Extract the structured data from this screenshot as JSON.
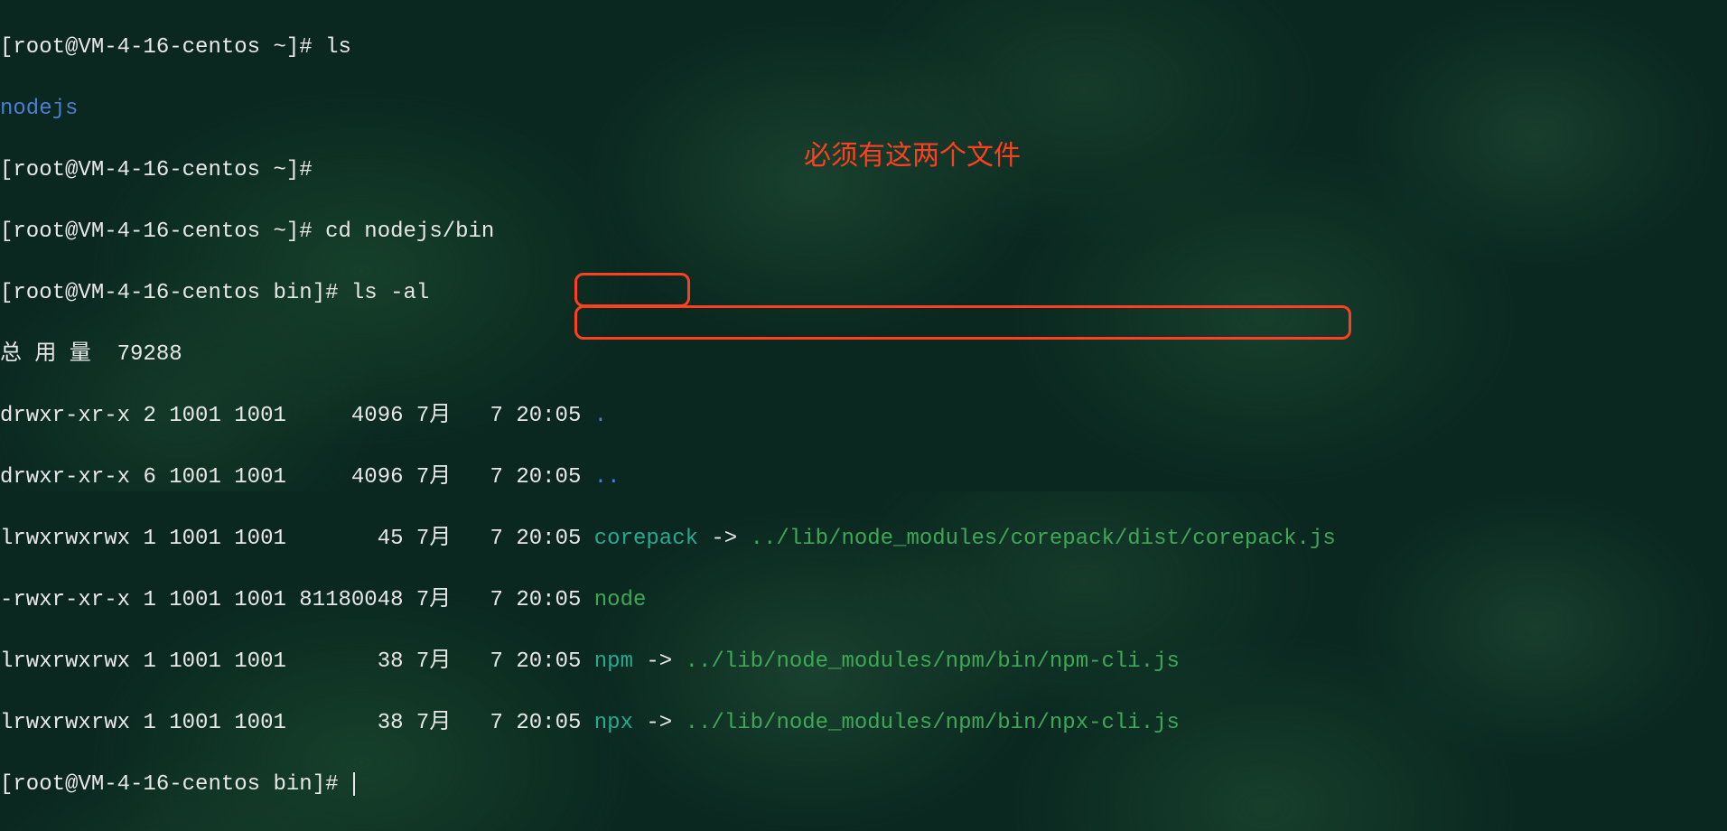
{
  "prompt": {
    "user": "root",
    "host": "VM-4-16-centos",
    "home_cwd": "~",
    "bin_cwd": "bin",
    "suffix": "#"
  },
  "commands": {
    "ls": "ls",
    "empty": "",
    "cd": "cd nodejs/bin",
    "lsal": "ls -al"
  },
  "ls_output": {
    "nodejs": "nodejs"
  },
  "lsal": {
    "total_label": "总 用 量",
    "total_value": "79288",
    "rows": [
      {
        "perms": "drwxr-xr-x",
        "links": "2",
        "owner": "1001",
        "group": "1001",
        "size": "4096",
        "month": "7月",
        "day": "7",
        "time": "20:05",
        "name": ".",
        "type": "dir"
      },
      {
        "perms": "drwxr-xr-x",
        "links": "6",
        "owner": "1001",
        "group": "1001",
        "size": "4096",
        "month": "7月",
        "day": "7",
        "time": "20:05",
        "name": "..",
        "type": "dir"
      },
      {
        "perms": "lrwxrwxrwx",
        "links": "1",
        "owner": "1001",
        "group": "1001",
        "size": "45",
        "month": "7月",
        "day": "7",
        "time": "20:05",
        "name": "corepack",
        "type": "link",
        "arrow": "->",
        "target": "../lib/node_modules/corepack/dist/corepack.js"
      },
      {
        "perms": "-rwxr-xr-x",
        "links": "1",
        "owner": "1001",
        "group": "1001",
        "size": "81180048",
        "month": "7月",
        "day": "7",
        "time": "20:05",
        "name": "node",
        "type": "exec"
      },
      {
        "perms": "lrwxrwxrwx",
        "links": "1",
        "owner": "1001",
        "group": "1001",
        "size": "38",
        "month": "7月",
        "day": "7",
        "time": "20:05",
        "name": "npm",
        "type": "link",
        "arrow": "->",
        "target": "../lib/node_modules/npm/bin/npm-cli.js"
      },
      {
        "perms": "lrwxrwxrwx",
        "links": "1",
        "owner": "1001",
        "group": "1001",
        "size": "38",
        "month": "7月",
        "day": "7",
        "time": "20:05",
        "name": "npx",
        "type": "link",
        "arrow": "->",
        "target": "../lib/node_modules/npm/bin/npx-cli.js"
      }
    ]
  },
  "annotation": {
    "text": "必须有这两个文件"
  }
}
